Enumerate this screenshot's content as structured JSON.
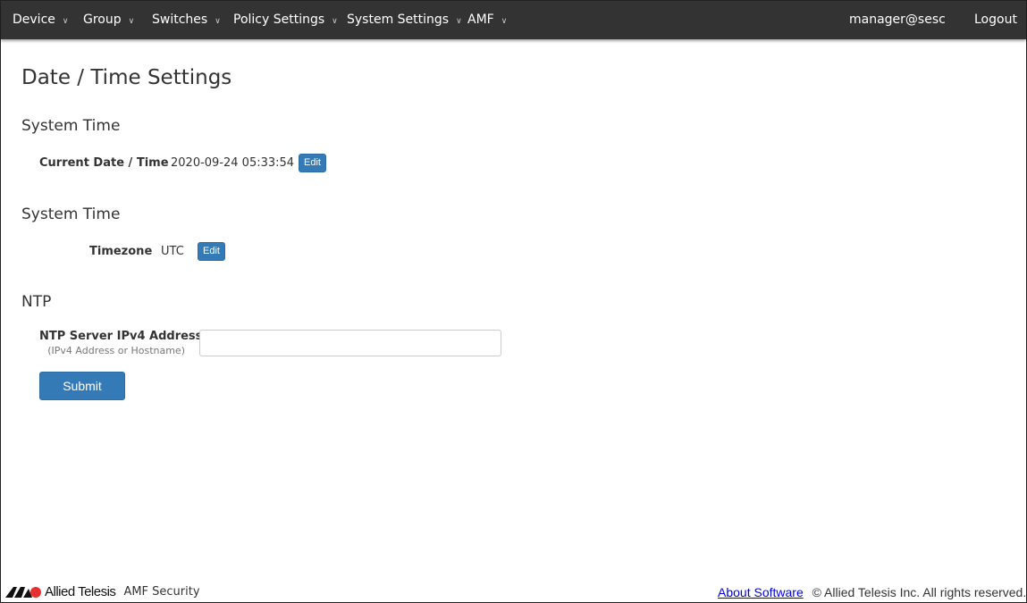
{
  "nav": {
    "items": [
      "Device",
      "Group",
      "Switches",
      "Policy Settings",
      "System Settings",
      "AMF"
    ],
    "user": "manager@sesc",
    "logout": "Logout"
  },
  "page_title": "Date / Time Settings",
  "system_time": {
    "heading": "System Time",
    "label": "Current Date / Time",
    "value": "2020-09-24 05:33:54",
    "edit": "Edit"
  },
  "timezone": {
    "heading": "System Time",
    "label": "Timezone",
    "value": "UTC",
    "edit": "Edit"
  },
  "ntp": {
    "heading": "NTP",
    "label": "NTP Server IPv4 Address",
    "sublabel": "(IPv4 Address or Hostname)",
    "value": "",
    "submit": "Submit"
  },
  "footer": {
    "brand": "Allied Telesis",
    "product": "AMF Security",
    "about": "About Software",
    "copyright": "© Allied Telesis Inc. All rights reserved."
  }
}
